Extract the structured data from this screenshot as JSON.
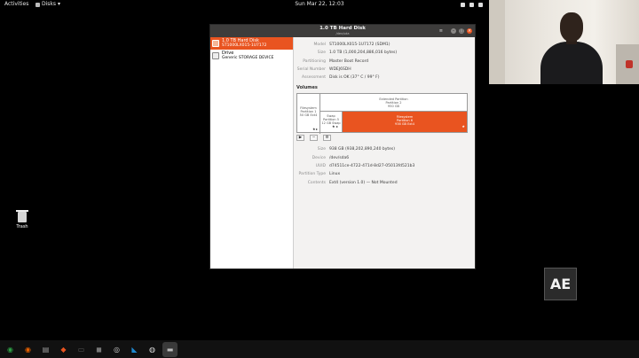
{
  "topbar": {
    "activities": "Activities",
    "app_menu": "Disks",
    "clock": "Sun Mar 22, 12:03"
  },
  "desktop": {
    "trash_label": "Trash"
  },
  "window": {
    "title": "1.0 TB Hard Disk",
    "subtitle": "/dev/sda",
    "menu_icon": "≡",
    "minimize": "–",
    "maximize": "□",
    "close": "×"
  },
  "devices": [
    {
      "name": "1.0 TB Hard Disk",
      "detail": "ST1000LX015-1U7172",
      "selected": true
    },
    {
      "name": "Drive",
      "detail": "Generic STORAGE DEVICE",
      "selected": false
    }
  ],
  "disk_info": [
    {
      "label": "Model",
      "value": "ST1000LX015-1U7172 (SDM1)"
    },
    {
      "label": "Size",
      "value": "1.0 TB (1,000,204,886,016 bytes)"
    },
    {
      "label": "Partitioning",
      "value": "Master Boot Record"
    },
    {
      "label": "Serial Number",
      "value": "WDEJ6SDH"
    },
    {
      "label": "Assessment",
      "value": "Disk is OK (37° C / 99° F)"
    }
  ],
  "volumes": {
    "title": "Volumes",
    "partition1": {
      "line1": "Filesystem",
      "line2": "Partition 1",
      "line3": "50 GB Ext4"
    },
    "extended": {
      "line1": "Extended Partition",
      "line2": "Partition 2",
      "line3": "950 GB"
    },
    "swap": {
      "line1": "Swap",
      "line2": "Partition 5",
      "line3": "12 GB Swap"
    },
    "partition6": {
      "line1": "Filesystem",
      "line2": "Partition 6",
      "line3": "938 GB Ext4"
    },
    "star": "★",
    "tools": {
      "play": "▶",
      "minus": "−",
      "gear": "⚙"
    }
  },
  "partition_info": [
    {
      "label": "Size",
      "value": "938 GB (938,202,890,240 bytes)"
    },
    {
      "label": "Device",
      "value": "/dev/sda6"
    },
    {
      "label": "UUID",
      "value": "d74511ce-4722-471d-8d27-05013fd521b3"
    },
    {
      "label": "Partition Type",
      "value": "Linux"
    },
    {
      "label": "Contents",
      "value": "Ext4 (version 1.0) — Not Mounted"
    }
  ],
  "badge": "AE",
  "dock": [
    {
      "name": "chrome-icon",
      "glyph": "◉",
      "color": "#2e9f45"
    },
    {
      "name": "firefox-icon",
      "glyph": "◉",
      "color": "#e66000"
    },
    {
      "name": "files-icon",
      "glyph": "▤",
      "color": "#9c9c9c"
    },
    {
      "name": "store-icon",
      "glyph": "◆",
      "color": "#e95420"
    },
    {
      "name": "terminal-icon",
      "glyph": "▭",
      "color": "#555555"
    },
    {
      "name": "screenshot-icon",
      "glyph": "◼",
      "color": "#777777"
    },
    {
      "name": "webcam-icon",
      "glyph": "◎",
      "color": "#cccccc"
    },
    {
      "name": "vscode-icon",
      "glyph": "◣",
      "color": "#1f8ad2"
    },
    {
      "name": "obs-icon",
      "glyph": "◍",
      "color": "#dddddd"
    },
    {
      "name": "disks-icon",
      "glyph": "▬",
      "color": "#bbbbbb",
      "active": true
    }
  ]
}
